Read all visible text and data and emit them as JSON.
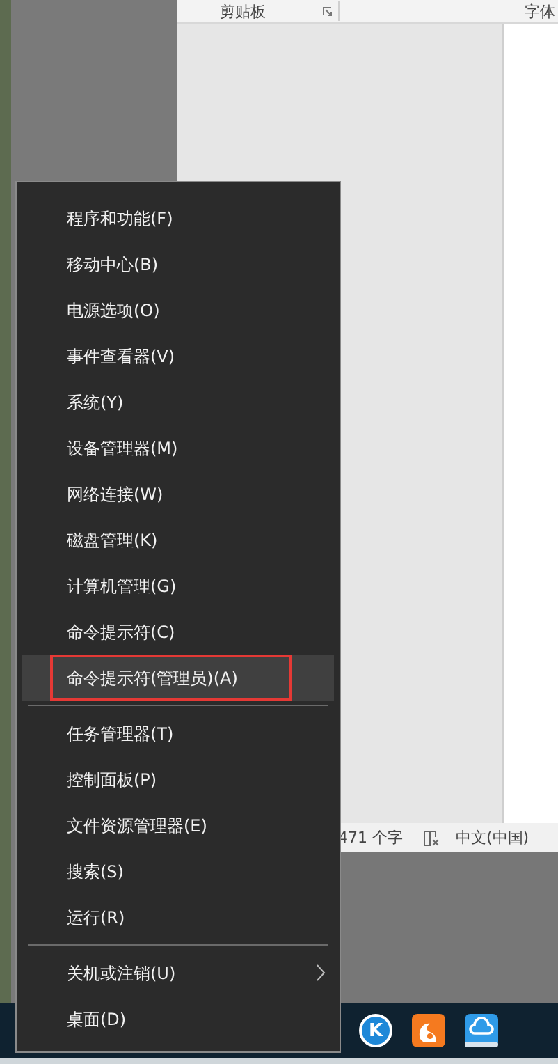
{
  "ribbon": {
    "groups": [
      {
        "label": "剪贴板",
        "launcher": true
      },
      {
        "label": "字体"
      }
    ]
  },
  "status_bar": {
    "word_count": "471 个字",
    "language": "中文(中国)"
  },
  "taskbar": {
    "apps": [
      {
        "kind": "letter",
        "letter": "K"
      },
      {
        "kind": "squirrel"
      },
      {
        "kind": "cloud"
      }
    ]
  },
  "menu": {
    "items": [
      {
        "kind": "item",
        "label": "程序和功能(F)",
        "selected": false,
        "has_submenu": false
      },
      {
        "kind": "item",
        "label": "移动中心(B)",
        "selected": false,
        "has_submenu": false
      },
      {
        "kind": "item",
        "label": "电源选项(O)",
        "selected": false,
        "has_submenu": false
      },
      {
        "kind": "item",
        "label": "事件查看器(V)",
        "selected": false,
        "has_submenu": false
      },
      {
        "kind": "item",
        "label": "系统(Y)",
        "selected": false,
        "has_submenu": false
      },
      {
        "kind": "item",
        "label": "设备管理器(M)",
        "selected": false,
        "has_submenu": false
      },
      {
        "kind": "item",
        "label": "网络连接(W)",
        "selected": false,
        "has_submenu": false
      },
      {
        "kind": "item",
        "label": "磁盘管理(K)",
        "selected": false,
        "has_submenu": false
      },
      {
        "kind": "item",
        "label": "计算机管理(G)",
        "selected": false,
        "has_submenu": false
      },
      {
        "kind": "item",
        "label": "命令提示符(C)",
        "selected": false,
        "has_submenu": false
      },
      {
        "kind": "item",
        "label": "命令提示符(管理员)(A)",
        "selected": true,
        "has_submenu": false
      },
      {
        "kind": "separator"
      },
      {
        "kind": "item",
        "label": "任务管理器(T)",
        "selected": false,
        "has_submenu": false
      },
      {
        "kind": "item",
        "label": "控制面板(P)",
        "selected": false,
        "has_submenu": false
      },
      {
        "kind": "item",
        "label": "文件资源管理器(E)",
        "selected": false,
        "has_submenu": false
      },
      {
        "kind": "item",
        "label": "搜索(S)",
        "selected": false,
        "has_submenu": false
      },
      {
        "kind": "item",
        "label": "运行(R)",
        "selected": false,
        "has_submenu": false
      },
      {
        "kind": "separator"
      },
      {
        "kind": "item",
        "label": "关机或注销(U)",
        "selected": false,
        "has_submenu": true
      },
      {
        "kind": "item",
        "label": "桌面(D)",
        "selected": false,
        "has_submenu": false
      }
    ]
  }
}
